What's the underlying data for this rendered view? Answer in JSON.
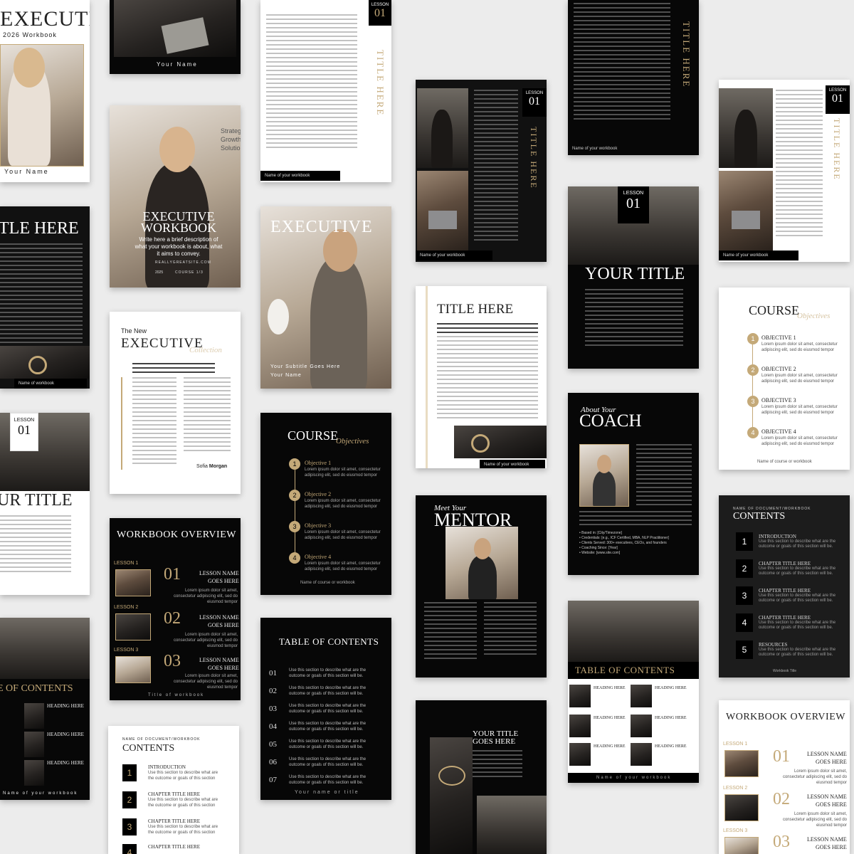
{
  "cover": {
    "title": "EXECUTIVE",
    "subtitle": "2026 Workbook",
    "name": "Your Name"
  },
  "top_photo": {
    "name": "Your Name"
  },
  "lesson_text_page": {
    "lesson_label": "LESSON",
    "lesson_number": "01",
    "vertical_title": "TITLE HERE",
    "footer": "Name of your workbook"
  },
  "smile_cover": {
    "title_line1": "EXECUTIVE",
    "title_line2": "WORKBOOK",
    "description": "Write here a brief description of what your workbook is about, what it aims to convey.",
    "website": "REALLYGREATSITE.COM",
    "year": "2025",
    "course": "COURSE 1/3",
    "bg_words": [
      "Strateg",
      "Growth",
      "Solutio"
    ]
  },
  "left_title_page": {
    "title": "TLE HERE",
    "footer": "Name of workbook"
  },
  "executive_cover2": {
    "title": "EXECUTIVE",
    "subtitle": "Your Subtitle Goes Here",
    "name": "Your Name"
  },
  "new_exec": {
    "kicker": "The New",
    "title": "EXECUTIVE",
    "script": "Collection",
    "signature_first": "Sofia",
    "signature_last": "Morgan"
  },
  "lesson_left": {
    "lesson_label": "LESSON",
    "lesson_number": "01",
    "title": "UR TITLE"
  },
  "course_dark": {
    "title": "COURSE",
    "script": "Objectives",
    "items": [
      {
        "num": "1",
        "label": "Objective 1",
        "text": "Lorem ipsum dolor sit amet, consectetur adipiscing elit, sed do eiusmod tempor"
      },
      {
        "num": "2",
        "label": "Objective 2",
        "text": "Lorem ipsum dolor sit amet, consectetur adipiscing elit, sed do eiusmod tempor"
      },
      {
        "num": "3",
        "label": "Objective 3",
        "text": "Lorem ipsum dolor sit amet, consectetur adipiscing elit, sed do eiusmod tempor"
      },
      {
        "num": "4",
        "label": "Objective 4",
        "text": "Lorem ipsum dolor sit amet, consectetur adipiscing elit, sed do eiusmod tempor"
      }
    ],
    "footer": "Name of course or workbook"
  },
  "overview_dark": {
    "title": "WORKBOOK OVERVIEW",
    "lessons": [
      {
        "label": "LESSON 1",
        "num": "01",
        "name1": "LESSON NAME",
        "name2": "GOES HERE",
        "text": "Lorem ipsum dolor sit amet, consectetur adipiscing elit, sed do eiusmod tempor"
      },
      {
        "label": "LESSON 2",
        "num": "02",
        "name1": "LESSON NAME",
        "name2": "GOES HERE",
        "text": "Lorem ipsum dolor sit amet, consectetur adipiscing elit, sed do eiusmod tempor"
      },
      {
        "label": "LESSON 3",
        "num": "03",
        "name1": "LESSON NAME",
        "name2": "GOES HERE",
        "text": "Lorem ipsum dolor sit amet, consectetur adipiscing elit, sed do eiusmod tempor"
      }
    ],
    "footer": "Title of workbook"
  },
  "toc_left": {
    "title": "E OF CONTENTS",
    "heading": "HEADING HERE",
    "footer": "Name of your workbook"
  },
  "contents_light": {
    "kicker": "NAME OF DOCUMENT/WORKBOOK",
    "title": "CONTENTS",
    "items": [
      {
        "num": "1",
        "label": "INTRODUCTION",
        "text": "Use this section to describe what are the outcome or goals of this section"
      },
      {
        "num": "2",
        "label": "CHAPTER TITLE HERE",
        "text": "Use this section to describe what are the outcome or goals of this section"
      },
      {
        "num": "3",
        "label": "CHAPTER TITLE HERE",
        "text": "Use this section to describe what are the outcome or goals of this section"
      },
      {
        "num": "4",
        "label": "CHAPTER TITLE HERE",
        "text": ""
      }
    ]
  },
  "toc_dark": {
    "title": "TABLE OF CONTENTS",
    "items": [
      {
        "num": "01",
        "text": "Use this section to describe what are the outcome or goals of this section will be."
      },
      {
        "num": "02",
        "text": "Use this section to describe what are the outcome or goals of this section will be."
      },
      {
        "num": "03",
        "text": "Use this section to describe what are the outcome or goals of this section will be."
      },
      {
        "num": "04",
        "text": "Use this section to describe what are the outcome or goals of this section will be."
      },
      {
        "num": "05",
        "text": "Use this section to describe what are the outcome or goals of this section will be."
      },
      {
        "num": "06",
        "text": "Use this section to describe what are the outcome or goals of this section will be."
      },
      {
        "num": "07",
        "text": "Use this section to describe what are the outcome or goals of this section will be."
      }
    ],
    "footer": "Your name or title"
  },
  "lesson_dark_photo": {
    "lesson_label": "LESSON",
    "lesson_number": "01",
    "vertical_title": "TITLE HERE",
    "footer": "Name of your workbook"
  },
  "title_light": {
    "title": "TITLE HERE",
    "footer": "Name of your workbook"
  },
  "mentor": {
    "kicker": "Meet Your",
    "title": "MENTOR"
  },
  "your_title_goes": {
    "line1": "YOUR TITLE",
    "line2": "GOES HERE"
  },
  "top_dark_text": {
    "vertical_title": "TITLE HERE",
    "footer": "Name of your workbook"
  },
  "your_title": {
    "lesson_label": "LESSON",
    "lesson_number": "01",
    "title": "YOUR TITLE"
  },
  "coach": {
    "kicker": "About Your",
    "title": "COACH",
    "bullets": [
      "Based in: [City/Timezone]",
      "Credentials: [e.g., ICF Certified, MBA, NLP Practitioner]",
      "Clients Served: 300+ executives, CEOs, and founders",
      "Coaching Since: [Year]",
      "Website: [www.site.com]"
    ]
  },
  "toc_right": {
    "title": "TABLE OF CONTENTS",
    "heading": "HEADING HERE",
    "footer": "Name of your workbook"
  },
  "lesson_right": {
    "lesson_label": "LESSON",
    "lesson_number": "01",
    "vertical_title": "TITLE HERE",
    "footer": "Name of your workbook"
  },
  "course_light": {
    "title": "COURSE",
    "script": "Objectives",
    "items": [
      {
        "num": "1",
        "label": "OBJECTIVE 1",
        "text": "Lorem ipsum dolor sit amet, consectetur adipiscing elit, sed do eiusmod tempor"
      },
      {
        "num": "2",
        "label": "OBJECTIVE 2",
        "text": "Lorem ipsum dolor sit amet, consectetur adipiscing elit, sed do eiusmod tempor"
      },
      {
        "num": "3",
        "label": "OBJECTIVE 3",
        "text": "Lorem ipsum dolor sit amet, consectetur adipiscing elit, sed do eiusmod tempor"
      },
      {
        "num": "4",
        "label": "OBJECTIVE 4",
        "text": "Lorem ipsum dolor sit amet, consectetur adipiscing elit, sed do eiusmod tempor"
      }
    ],
    "footer": "Name of course or workbook"
  },
  "contents_dark": {
    "kicker": "NAME OF DOCUMENT/WORKBOOK",
    "title": "CONTENTS",
    "items": [
      {
        "num": "1",
        "label": "INTRODUCTION",
        "text": "Use this section to describe what are the outcome or goals of this section will be."
      },
      {
        "num": "2",
        "label": "CHAPTER TITLE HERE",
        "text": "Use this section to describe what are the outcome or goals of this section will be."
      },
      {
        "num": "3",
        "label": "CHAPTER TITLE HERE",
        "text": "Use this section to describe what are the outcome or goals of this section will be."
      },
      {
        "num": "4",
        "label": "CHAPTER TITLE HERE",
        "text": "Use this section to describe what are the outcome or goals of this section will be."
      },
      {
        "num": "5",
        "label": "RESOURCES",
        "text": "Use this section to describe what are the outcome or goals of this section will be."
      }
    ],
    "footer": "Workbook Title"
  },
  "overview_light": {
    "title": "WORKBOOK OVERVIEW",
    "lessons": [
      {
        "label": "LESSON 1",
        "num": "01",
        "name1": "LESSON NAME",
        "name2": "GOES HERE",
        "text": "Lorem ipsum dolor sit amet, consectetur adipiscing elit, sed do eiusmod tempor"
      },
      {
        "label": "LESSON 2",
        "num": "02",
        "name1": "LESSON NAME",
        "name2": "GOES HERE",
        "text": "Lorem ipsum dolor sit amet, consectetur adipiscing elit, sed do eiusmod tempor"
      },
      {
        "label": "LESSON 3",
        "num": "03",
        "name1": "LESSON NAME",
        "name2": "GOES HERE",
        "text": ""
      }
    ]
  },
  "colors": {
    "gold": "#c4a978",
    "black": "#070707",
    "white": "#ffffff"
  }
}
